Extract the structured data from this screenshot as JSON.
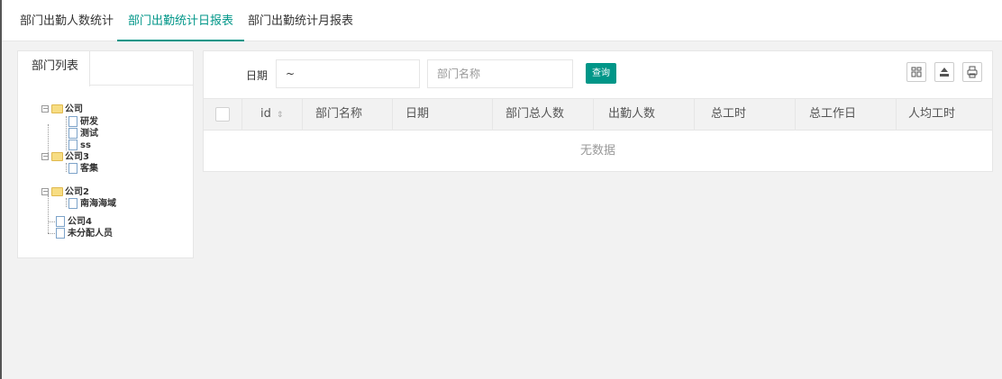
{
  "tabs": [
    {
      "label": "部门出勤人数统计",
      "active": false
    },
    {
      "label": "部门出勤统计日报表",
      "active": true
    },
    {
      "label": "部门出勤统计月报表",
      "active": false
    }
  ],
  "left_panel": {
    "tab_label": "部门列表",
    "tree": [
      {
        "label": "公司",
        "type": "folder",
        "expanded": true
      },
      {
        "label": "研发",
        "type": "file"
      },
      {
        "label": "测试",
        "type": "file"
      },
      {
        "label": "ss",
        "type": "file"
      },
      {
        "label": "公司3",
        "type": "folder",
        "expanded": true
      },
      {
        "label": "客集",
        "type": "file"
      },
      {
        "label": "公司2",
        "type": "folder",
        "expanded": true
      },
      {
        "label": "南海海域",
        "type": "file"
      },
      {
        "label": "公司4",
        "type": "file"
      },
      {
        "label": "未分配人员",
        "type": "file"
      }
    ]
  },
  "search": {
    "date_label": "日期",
    "date_value": "~",
    "dept_placeholder": "部门名称",
    "query_label": "查询"
  },
  "toolbar_icons": [
    "columns-icon",
    "export-icon",
    "print-icon"
  ],
  "table": {
    "columns": [
      "id",
      "部门名称",
      "日期",
      "部门总人数",
      "出勤人数",
      "总工时",
      "总工作日",
      "人均工时"
    ],
    "empty_text": "无数据"
  },
  "colors": {
    "accent": "#009688"
  }
}
